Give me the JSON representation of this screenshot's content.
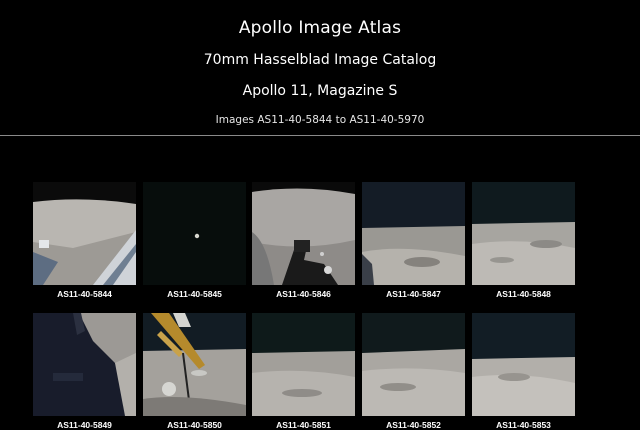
{
  "header": {
    "title": "Apollo Image Atlas",
    "subtitle_1": "70mm Hasselblad Image Catalog",
    "subtitle_2": "Apollo 11, Magazine S",
    "range": "Images AS11-40-5844 to AS11-40-5970"
  },
  "thumbnails": [
    {
      "id": "AS11-40-5844"
    },
    {
      "id": "AS11-40-5845"
    },
    {
      "id": "AS11-40-5846"
    },
    {
      "id": "AS11-40-5847"
    },
    {
      "id": "AS11-40-5848"
    },
    {
      "id": "AS11-40-5849"
    },
    {
      "id": "AS11-40-5850"
    },
    {
      "id": "AS11-40-5851"
    },
    {
      "id": "AS11-40-5852"
    },
    {
      "id": "AS11-40-5853"
    }
  ]
}
